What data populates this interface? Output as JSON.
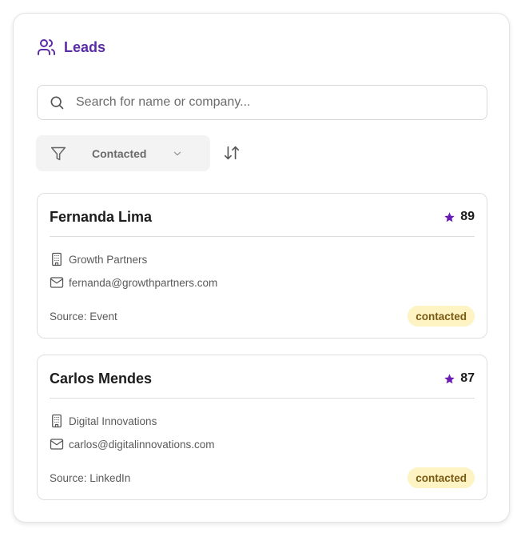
{
  "header": {
    "title": "Leads",
    "icon": "users-icon"
  },
  "search": {
    "placeholder": "Search for name or company...",
    "value": ""
  },
  "filter": {
    "selected": "Contacted"
  },
  "leads": [
    {
      "name": "Fernanda Lima",
      "score": "89",
      "company": "Growth Partners",
      "email": "fernanda@growthpartners.com",
      "source": "Source: Event",
      "status": "contacted"
    },
    {
      "name": "Carlos Mendes",
      "score": "87",
      "company": "Digital Innovations",
      "email": "carlos@digitalinnovations.com",
      "source": "Source: LinkedIn",
      "status": "contacted"
    }
  ],
  "colors": {
    "accent": "#5b2ba8",
    "star": "#6a1bb5",
    "badge_bg": "#fdf3c3",
    "badge_text": "#7a5a12"
  }
}
